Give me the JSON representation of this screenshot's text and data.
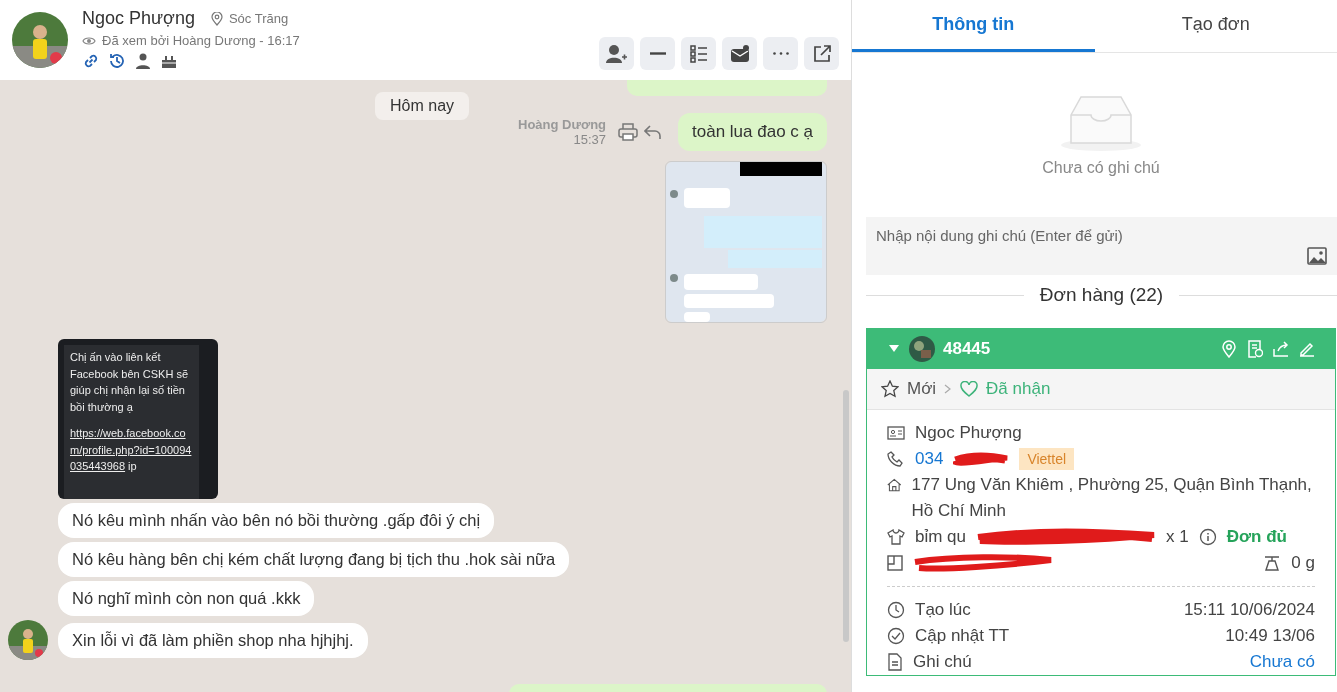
{
  "chat": {
    "contact": {
      "name": "Ngoc Phượng",
      "location": "Sóc Trăng",
      "seen": "Đã xem bởi Hoàng Dương - 16:17"
    },
    "messages": [
      {
        "kind": "date",
        "text": "Hôm nay"
      },
      {
        "kind": "outgoing",
        "sender": "Hoàng Dương",
        "time": "15:37",
        "text": "toàn lua đao c ạ"
      },
      {
        "kind": "outgoing_picture"
      },
      {
        "kind": "incoming_screenshot",
        "text": "Chị ấn vào liên kết Facebook bên CSKH sẽ giúp chị nhận lại số tiền bồi thường ạ",
        "link": "https://web.facebook.com/profile.php?id=100094035443968",
        "suffix": "ip"
      },
      {
        "kind": "incoming",
        "text": "Nó kêu mình nhấn vào bên nó bồi thường .gấp đôi ý chị",
        "avatar": false
      },
      {
        "kind": "incoming",
        "text": "Nó kêu hàng bên chị kém chất lượng đang bị tịch thu .hok sài nữa",
        "avatar": false
      },
      {
        "kind": "incoming",
        "text": "Nó nghĩ mình còn non quá .kkk",
        "avatar": false
      },
      {
        "kind": "incoming",
        "text": "Xin lỗi vì đã làm phiền shop nha hjhjhj.",
        "avatar": true
      }
    ]
  },
  "panel": {
    "tabs": [
      {
        "label": "Thông tin",
        "selected": true
      },
      {
        "label": "Tạo đơn",
        "selected": false
      }
    ],
    "notes": {
      "empty": "Chưa có ghi chú",
      "placeholder": "Nhập nội dung ghi chú (Enter để gửi)"
    },
    "orders_title": "Đơn hàng (22)",
    "order": {
      "id": "48445",
      "status_from": "Mới",
      "status_to": "Đã nhận",
      "customer": "Ngoc Phượng",
      "phone": "034",
      "carrier": "Viettel",
      "address": "177 Ung Văn Khiêm , Phường 25, Quận Bình Thạnh, Hồ Chí Minh",
      "product": "bỉm qu",
      "quantity": "x 1",
      "stock": "Đơn đủ",
      "weight": "0 g",
      "details": [
        {
          "kind": "time",
          "label": "Tạo lúc",
          "value": "15:11 10/06/2024",
          "link": false
        },
        {
          "kind": "check",
          "label": "Cập nhật TT",
          "value": "10:49 13/06",
          "link": false
        },
        {
          "kind": "note",
          "label": "Ghi chú",
          "value": "Chưa có",
          "link": true
        }
      ]
    }
  }
}
